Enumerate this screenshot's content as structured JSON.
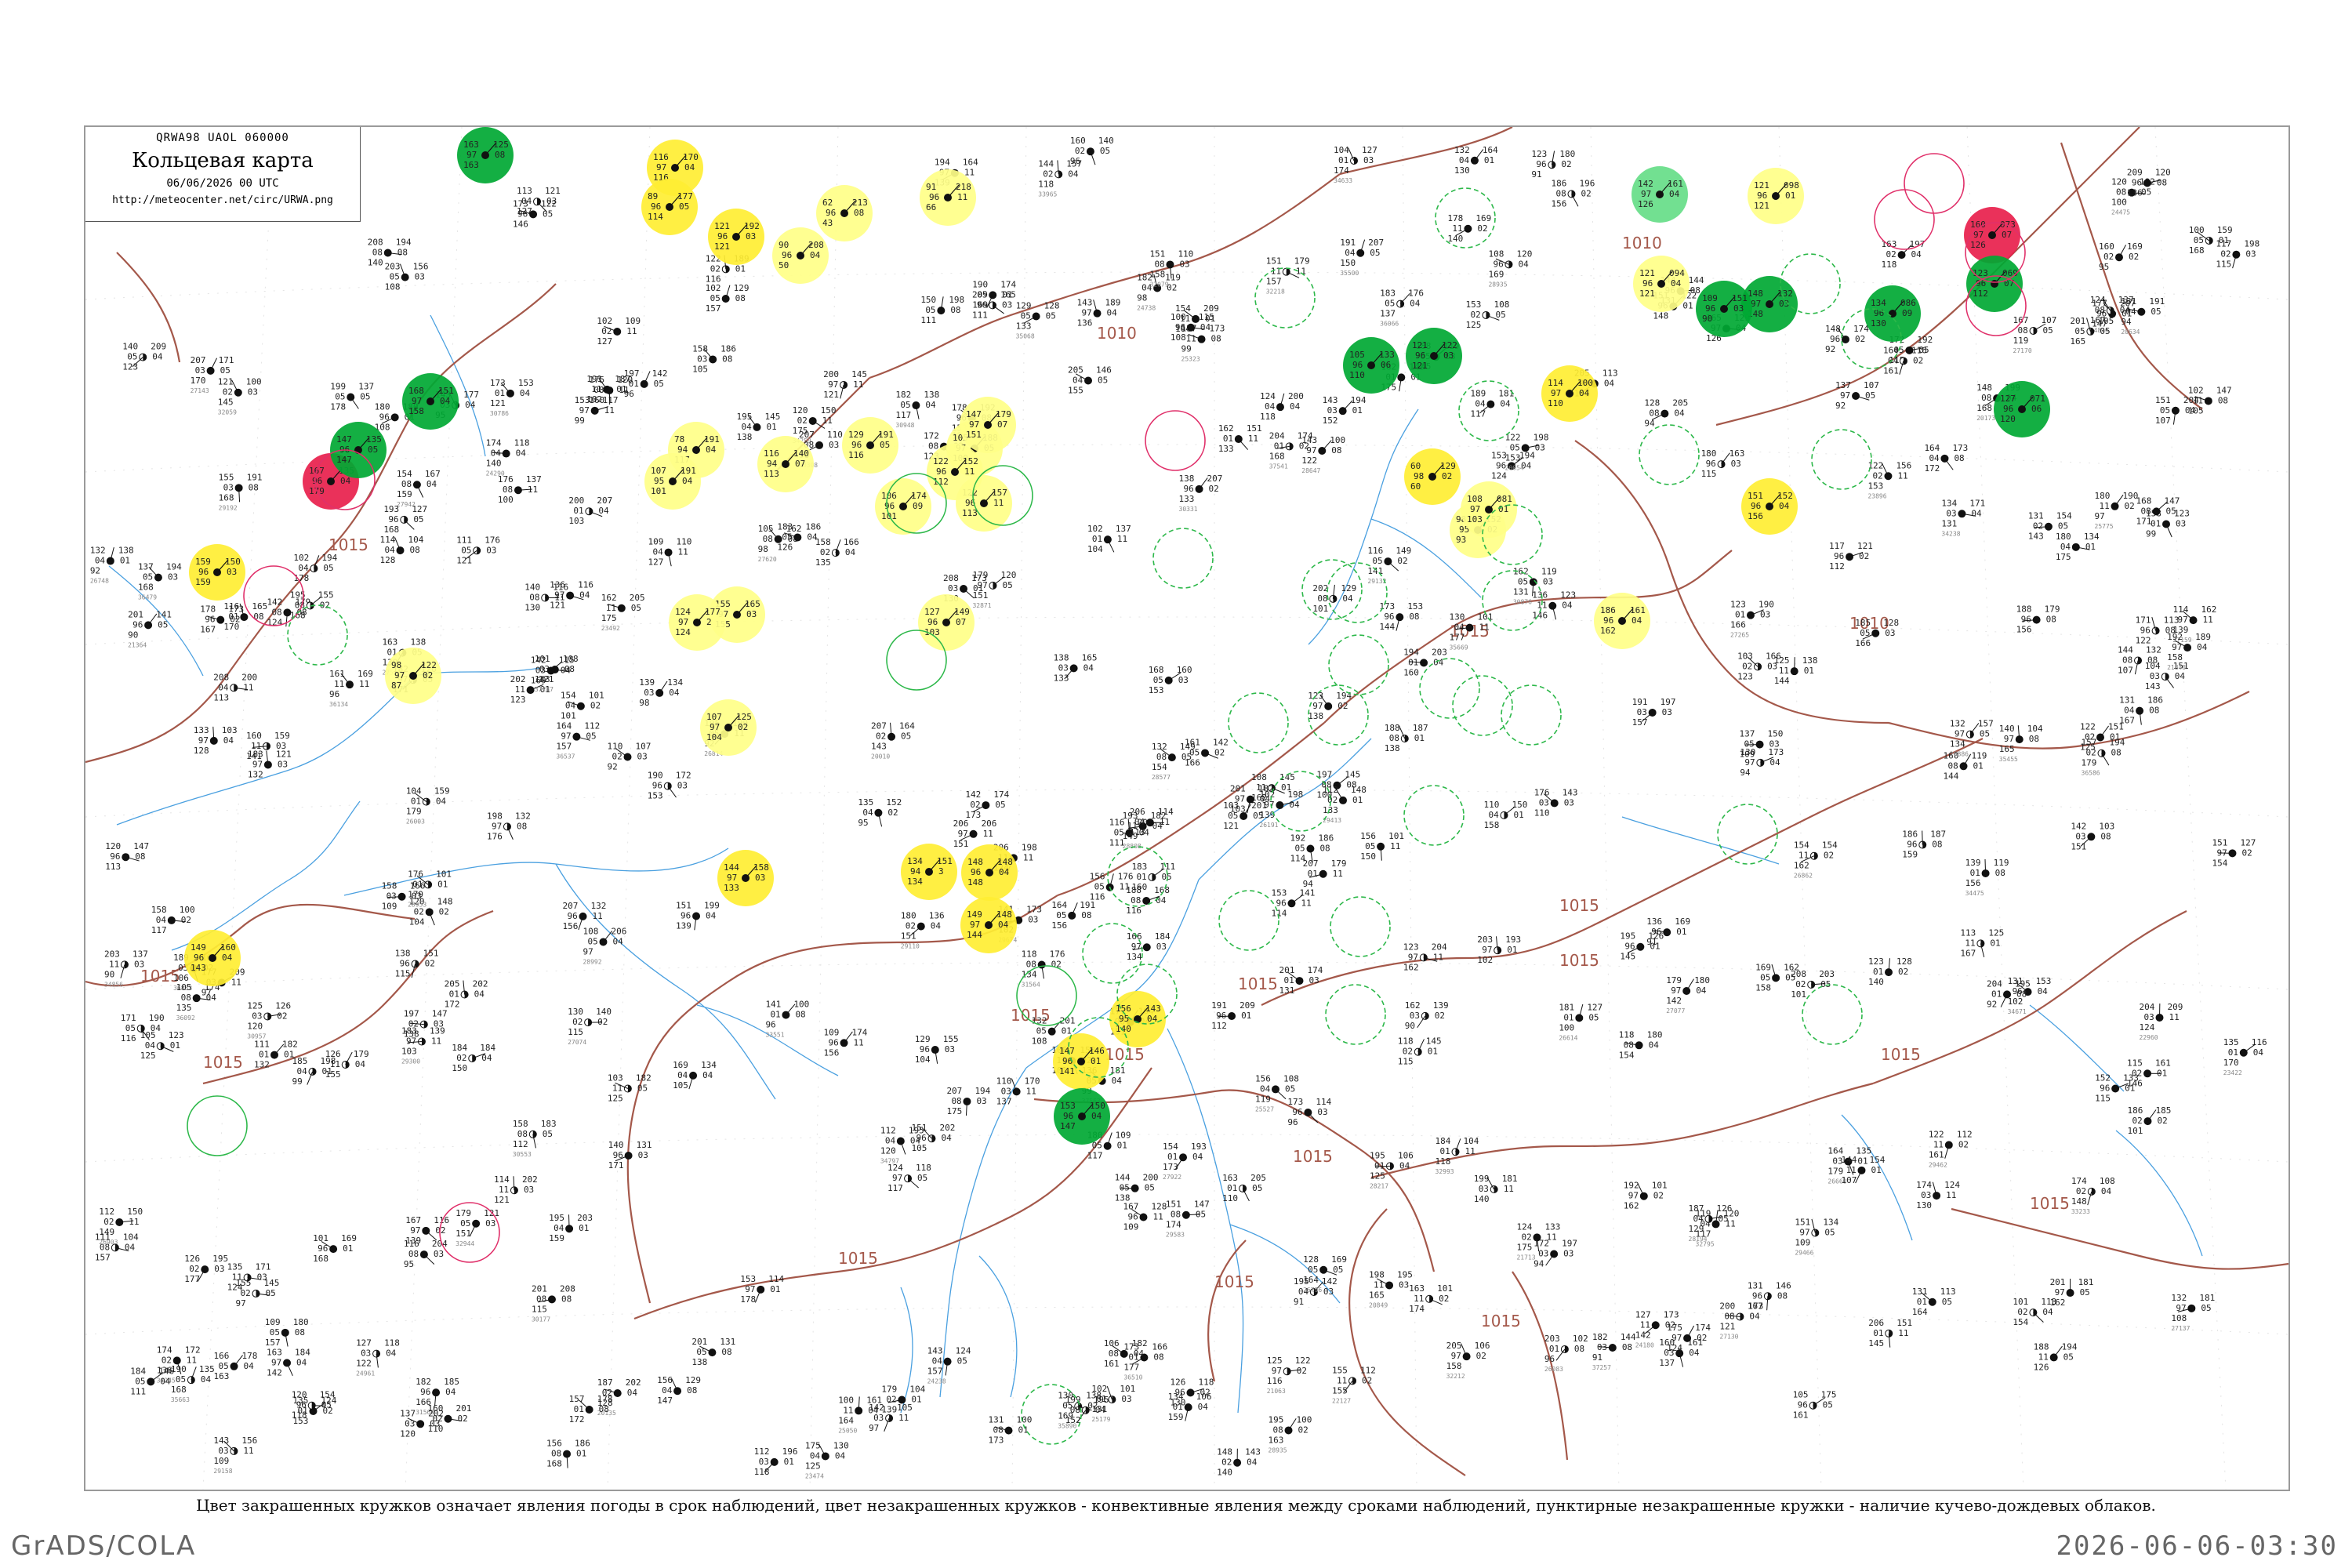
{
  "header": {
    "code": "QRWA98  UAOL  060000",
    "title": "Кольцевая карта",
    "time": "06/06/2026 00 UTC",
    "url": "http://meteocenter.net/circ/URWA.png"
  },
  "caption": "Цвет закрашенных кружков означает явления погоды в срок наблюдений, цвет незакрашенных кружков - конвективные явления между сроками наблюдений, пунктирные незакрашенные кружки - наличие кучево-дождевых облаков.",
  "footer": {
    "brand": "GrADS/COLA",
    "timestamp": "2026-06-06-03:30"
  },
  "colors": {
    "green": "#00a833",
    "light_green": "#66dd88",
    "yellow": "#ffee33",
    "pale_yellow": "#ffff88",
    "red": "#e8204c",
    "isobar": "#a4584a",
    "river": "#4aa0e0"
  },
  "isobar_labels": [
    "1015",
    "1015",
    "1015",
    "1015",
    "1015",
    "1015",
    "1015",
    "1015",
    "1015",
    "1015",
    "1015",
    "1015",
    "1010",
    "1010",
    "1010",
    "1015",
    "1015",
    "1015"
  ],
  "stations": [
    {
      "fill": "green",
      "l1": "163",
      "l2": "97",
      "l3": "163",
      "r1": "125",
      "r2": "08"
    },
    {
      "fill": "yellow",
      "l1": "116",
      "l2": "97",
      "l3": "116",
      "r1": "170",
      "r2": "04"
    },
    {
      "fill": "yellow",
      "l1": "89",
      "l2": "96",
      "l3": "114",
      "r1": "177",
      "r2": "05"
    },
    {
      "fill": "yellow",
      "l1": "121",
      "l2": "96",
      "l3": "121",
      "r1": "192",
      "r2": "03"
    },
    {
      "fill": "pale_yellow",
      "l1": "62",
      "l2": "96",
      "l3": "43",
      "r1": "213",
      "r2": "08"
    },
    {
      "fill": "pale_yellow",
      "l1": "90",
      "l2": "96",
      "l3": "50",
      "r1": "208",
      "r2": "04"
    },
    {
      "fill": "pale_yellow",
      "l1": "91",
      "l2": "96",
      "l3": "66",
      "r1": "218",
      "r2": "11"
    },
    {
      "fill": "light_green",
      "l1": "142",
      "l2": "97",
      "l3": "126",
      "r1": "161",
      "r2": "04"
    },
    {
      "fill": "pale_yellow",
      "l1": "121",
      "l2": "96",
      "l3": "121",
      "r1": "098",
      "r2": "01"
    },
    {
      "fill": "red",
      "l1": "160",
      "l2": "97",
      "l3": "126",
      "r1": "073",
      "r2": "07"
    },
    {
      "fill": "green",
      "l1": "148",
      "l2": "97",
      "l3": "148",
      "r1": "132",
      "r2": "03"
    },
    {
      "fill": "green",
      "l1": "109",
      "l2": "96",
      "l3": "90",
      "r1": "151",
      "r2": "03"
    },
    {
      "fill": "green",
      "l1": "105",
      "l2": "96",
      "l3": "110",
      "r1": "133",
      "r2": "06"
    },
    {
      "fill": "green",
      "l1": "121",
      "l2": "96",
      "l3": "121",
      "r1": "122",
      "r2": "03"
    },
    {
      "fill": "yellow",
      "l1": "114",
      "l2": "97",
      "l3": "110",
      "r1": "100",
      "r2": "04"
    },
    {
      "fill": "pale_yellow",
      "l1": "121",
      "l2": "96",
      "l3": "121",
      "r1": "094",
      "r2": "04"
    },
    {
      "fill": "green",
      "l1": "134",
      "l2": "96",
      "l3": "130",
      "r1": "086",
      "r2": "09"
    },
    {
      "fill": "green",
      "l1": "123",
      "l2": "96",
      "l3": "112",
      "r1": "069",
      "r2": "07"
    },
    {
      "fill": "green",
      "l1": "127",
      "l2": "96",
      "l3": "120",
      "r1": "071",
      "r2": "06"
    },
    {
      "fill": "green",
      "l1": "168",
      "l2": "97",
      "l3": "158",
      "r1": "151",
      "r2": "04"
    },
    {
      "fill": "red",
      "l1": "167",
      "l2": "96",
      "l3": "179",
      "r1": "135",
      "r2": "04"
    },
    {
      "fill": "green",
      "l1": "147",
      "l2": "96",
      "l3": "147",
      "r1": "135",
      "r2": "05"
    },
    {
      "fill": "yellow",
      "l1": "159",
      "l2": "96",
      "l3": "159",
      "r1": "150",
      "r2": "03"
    },
    {
      "fill": "pale_yellow",
      "l1": "78",
      "l2": "94",
      "l3": "117",
      "r1": "191",
      "r2": "04"
    },
    {
      "fill": "pale_yellow",
      "l1": "107",
      "l2": "95",
      "l3": "101",
      "r1": "191",
      "r2": "04"
    },
    {
      "fill": "pale_yellow",
      "l1": "116",
      "l2": "94",
      "l3": "113",
      "r1": "140",
      "r2": "07"
    },
    {
      "fill": "pale_yellow",
      "l1": "106",
      "l2": "96",
      "l3": "101",
      "r1": "174",
      "r2": "09"
    },
    {
      "fill": "pale_yellow",
      "l1": "122",
      "l2": "96",
      "l3": "113",
      "r1": "157",
      "r2": "11"
    },
    {
      "fill": "pale_yellow",
      "l1": "105",
      "l2": "97",
      "l3": "100",
      "r1": "188",
      "r2": "05"
    },
    {
      "fill": "pale_yellow",
      "l1": "129",
      "l2": "96",
      "l3": "116",
      "r1": "191",
      "r2": "05"
    },
    {
      "fill": "pale_yellow",
      "l1": "147",
      "l2": "97",
      "l3": "151",
      "r1": "179",
      "r2": "07"
    },
    {
      "fill": "pale_yellow",
      "l1": "122",
      "l2": "96",
      "l3": "112",
      "r1": "152",
      "r2": "11"
    },
    {
      "fill": "pale_yellow",
      "l1": "127",
      "l2": "96",
      "l3": "103",
      "r1": "149",
      "r2": "07"
    },
    {
      "fill": "pale_yellow",
      "l1": "155",
      "l2": "97",
      "l3": "155",
      "r1": "165",
      "r2": "03"
    },
    {
      "fill": "pale_yellow",
      "l1": "124",
      "l2": "97",
      "l3": "124",
      "r1": "177",
      "r2": "2"
    },
    {
      "fill": "pale_yellow",
      "l1": "98",
      "l2": "97",
      "l3": "87",
      "r1": "122",
      "r2": "02"
    },
    {
      "fill": "pale_yellow",
      "l1": "107",
      "l2": "97",
      "l3": "104",
      "r1": "125",
      "r2": "02"
    },
    {
      "fill": "pale_yellow",
      "l1": "98",
      "l2": "95",
      "l3": "93",
      "r1": "152",
      "r2": "02"
    },
    {
      "fill": "yellow",
      "l1": "60",
      "l2": "98",
      "l3": "60",
      "r1": "129",
      "r2": "02"
    },
    {
      "fill": "pale_yellow",
      "l1": "108",
      "l2": "97",
      "l3": "103",
      "r1": "081",
      "r2": "01"
    },
    {
      "fill": "pale_yellow",
      "l1": "186",
      "l2": "96",
      "l3": "162",
      "r1": "161",
      "r2": "04"
    },
    {
      "fill": "yellow",
      "l1": "151",
      "l2": "96",
      "l3": "156",
      "r1": "152",
      "r2": "04"
    },
    {
      "fill": "yellow",
      "l1": "144",
      "l2": "97",
      "l3": "133",
      "r1": "158",
      "r2": "03"
    },
    {
      "fill": "yellow",
      "l1": "149",
      "l2": "96",
      "l3": "143",
      "r1": "160",
      "r2": "04"
    },
    {
      "fill": "yellow",
      "l1": "134",
      "l2": "94",
      "l3": "134",
      "r1": "151",
      "r2": "3"
    },
    {
      "fill": "yellow",
      "l1": "148",
      "l2": "96",
      "l3": "148",
      "r1": "148",
      "r2": "04"
    },
    {
      "fill": "yellow",
      "l1": "149",
      "l2": "97",
      "l3": "144",
      "r1": "148",
      "r2": "04"
    },
    {
      "fill": "yellow",
      "l1": "156",
      "l2": "95",
      "l3": "140",
      "r1": "143",
      "r2": "04"
    },
    {
      "fill": "yellow",
      "l1": "147",
      "l2": "96",
      "l3": "141",
      "r1": "146",
      "r2": "01"
    },
    {
      "fill": "green",
      "l1": "153",
      "l2": "96",
      "l3": "147",
      "r1": "150",
      "r2": "04"
    }
  ]
}
